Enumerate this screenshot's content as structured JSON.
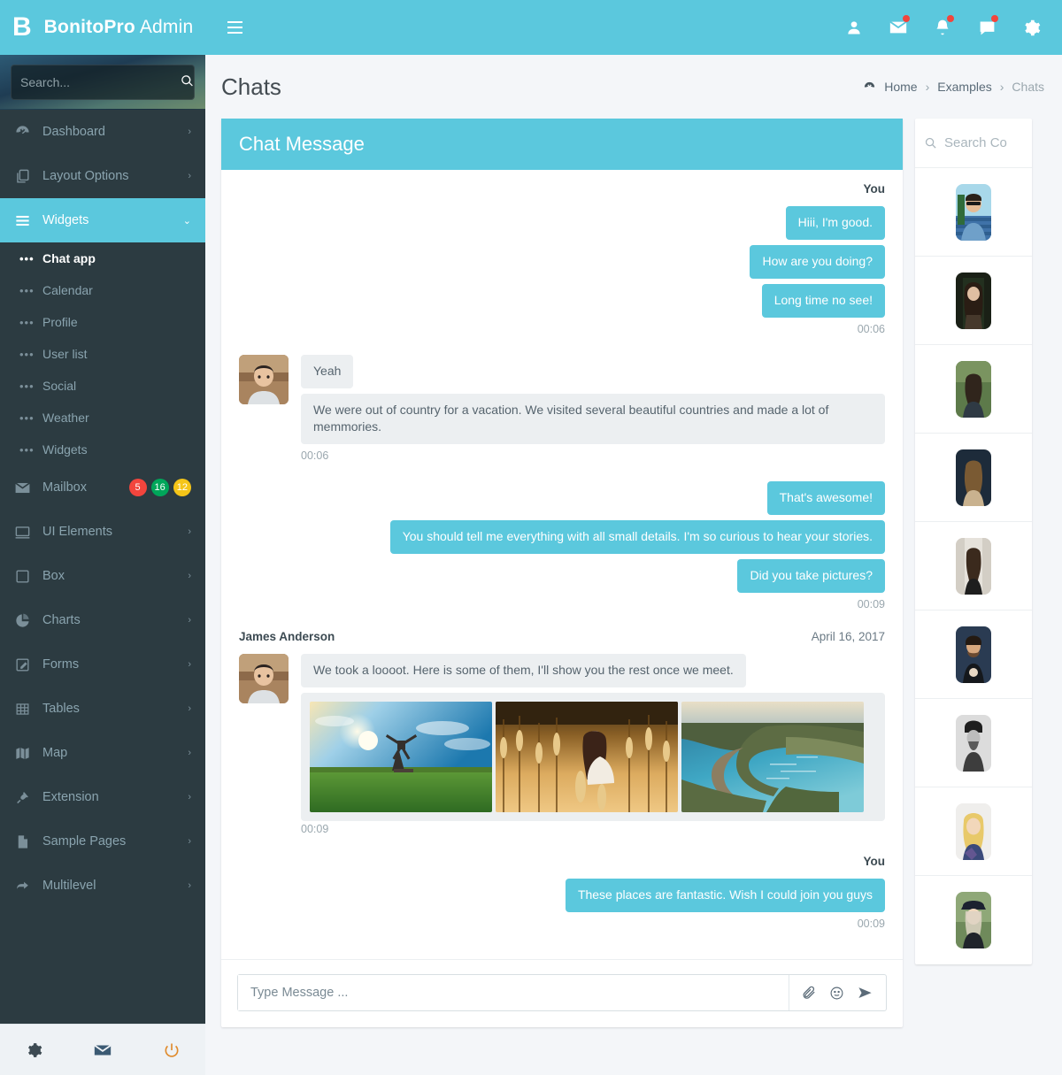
{
  "brand": {
    "logo": "B",
    "name_bold": "BonitoPro",
    "name_light": " Admin"
  },
  "topnav": {
    "menu_toggle": "menu-icon",
    "items": [
      {
        "icon": "user-icon",
        "name": "user",
        "dot": false
      },
      {
        "icon": "envelope-icon",
        "name": "messages",
        "dot": true
      },
      {
        "icon": "bell-icon",
        "name": "notifications",
        "dot": true
      },
      {
        "icon": "comment-icon",
        "name": "chat",
        "dot": true
      },
      {
        "icon": "gear-icon",
        "name": "settings",
        "dot": false
      }
    ]
  },
  "sidebar": {
    "search_placeholder": "Search...",
    "search_value": "",
    "search_icon": "search-icon",
    "items": [
      {
        "label": "Dashboard",
        "icon": "dashboard-icon",
        "arrow": "›",
        "active": false
      },
      {
        "label": "Layout Options",
        "icon": "layers-icon",
        "arrow": "›",
        "active": false
      },
      {
        "label": "Widgets",
        "icon": "bars-icon",
        "arrow": "⌄",
        "active": true
      }
    ],
    "submenu": [
      {
        "label": "Chat app",
        "active": true
      },
      {
        "label": "Calendar",
        "active": false
      },
      {
        "label": "Profile",
        "active": false
      },
      {
        "label": "User list",
        "active": false
      },
      {
        "label": "Social",
        "active": false
      },
      {
        "label": "Weather",
        "active": false
      },
      {
        "label": "Widgets",
        "active": false
      }
    ],
    "mailbox": {
      "label": "Mailbox",
      "icon": "envelope-icon",
      "badges": [
        {
          "value": "5",
          "color": "#f2453d"
        },
        {
          "value": "16",
          "color": "#00a65a"
        },
        {
          "value": "12",
          "color": "#f5c518"
        }
      ]
    },
    "items2": [
      {
        "label": "UI Elements",
        "icon": "window-icon",
        "arrow": "›"
      },
      {
        "label": "Box",
        "icon": "square-icon",
        "arrow": "›"
      },
      {
        "label": "Charts",
        "icon": "pie-chart-icon",
        "arrow": "›"
      },
      {
        "label": "Forms",
        "icon": "edit-icon",
        "arrow": "›"
      },
      {
        "label": "Tables",
        "icon": "table-icon",
        "arrow": "›"
      },
      {
        "label": "Map",
        "icon": "map-icon",
        "arrow": "›"
      },
      {
        "label": "Extension",
        "icon": "plug-icon",
        "arrow": "›"
      },
      {
        "label": "Sample Pages",
        "icon": "file-icon",
        "arrow": "›"
      },
      {
        "label": "Multilevel",
        "icon": "share-icon",
        "arrow": "›"
      }
    ],
    "footer": [
      {
        "icon": "gear-icon",
        "name": "settings",
        "color": "#3c4a52"
      },
      {
        "icon": "envelope-icon",
        "name": "mail",
        "color": "#3b5a73"
      },
      {
        "icon": "power-icon",
        "name": "logout",
        "color": "#e08b2c"
      }
    ]
  },
  "page": {
    "title": "Chats",
    "breadcrumb": [
      {
        "label": "Home",
        "icon": "dashboard-icon",
        "current": false
      },
      {
        "label": "Examples",
        "icon": "",
        "current": false
      },
      {
        "label": "Chats",
        "icon": "",
        "current": true
      }
    ],
    "breadcrumb_separator": "›"
  },
  "chat": {
    "header_title": "Chat Message",
    "groups": [
      {
        "side": "out",
        "name": "You",
        "date": "",
        "messages": [
          "Hiii, I'm good.",
          "How are you doing?",
          "Long time no see!"
        ],
        "time": "00:06"
      },
      {
        "side": "in",
        "name": "",
        "date": "",
        "messages": [
          "Yeah",
          "We were out of country for a vacation. We visited several beautiful countries and made a lot of memmories."
        ],
        "time": "00:06"
      },
      {
        "side": "out",
        "name": "",
        "date": "",
        "messages": [
          "That's awesome!",
          "You should tell me everything with all small details. I'm so curious to hear your stories.",
          "Did you take pictures?"
        ],
        "time": "00:09"
      },
      {
        "side": "in",
        "name": "James Anderson",
        "date": "April 16, 2017",
        "messages": [
          "We took a loooot. Here is some of them, I'll show you the rest once we meet."
        ],
        "gallery": [
          "windmill-field-photo",
          "woman-in-wheat-field-photo",
          "coastal-bay-photo"
        ],
        "time": "00:09"
      },
      {
        "side": "out",
        "name": "You",
        "date": "",
        "messages": [
          "These places are fantastic. Wish I could join you guys"
        ],
        "time": "00:09"
      }
    ],
    "input_placeholder": "Type Message ...",
    "input_value": "",
    "tools": [
      {
        "icon": "paperclip-icon",
        "name": "attach"
      },
      {
        "icon": "smiley-icon",
        "name": "emoji"
      },
      {
        "icon": "send-icon",
        "name": "send"
      }
    ]
  },
  "contacts": {
    "search_placeholder": "Search Co",
    "search_value": "",
    "search_icon": "search-icon",
    "items": [
      {
        "name": "contact-1"
      },
      {
        "name": "contact-2"
      },
      {
        "name": "contact-3"
      },
      {
        "name": "contact-4"
      },
      {
        "name": "contact-5"
      },
      {
        "name": "contact-6"
      },
      {
        "name": "contact-7"
      },
      {
        "name": "contact-8"
      },
      {
        "name": "contact-9"
      }
    ]
  },
  "colors": {
    "accent": "#5bc8dd",
    "sidebar_bg": "#2c3b41",
    "page_bg": "#f4f6f9",
    "bubble_in": "#eceff1",
    "badge_red": "#f2453d",
    "badge_green": "#00a65a",
    "badge_yellow": "#f5c518"
  }
}
